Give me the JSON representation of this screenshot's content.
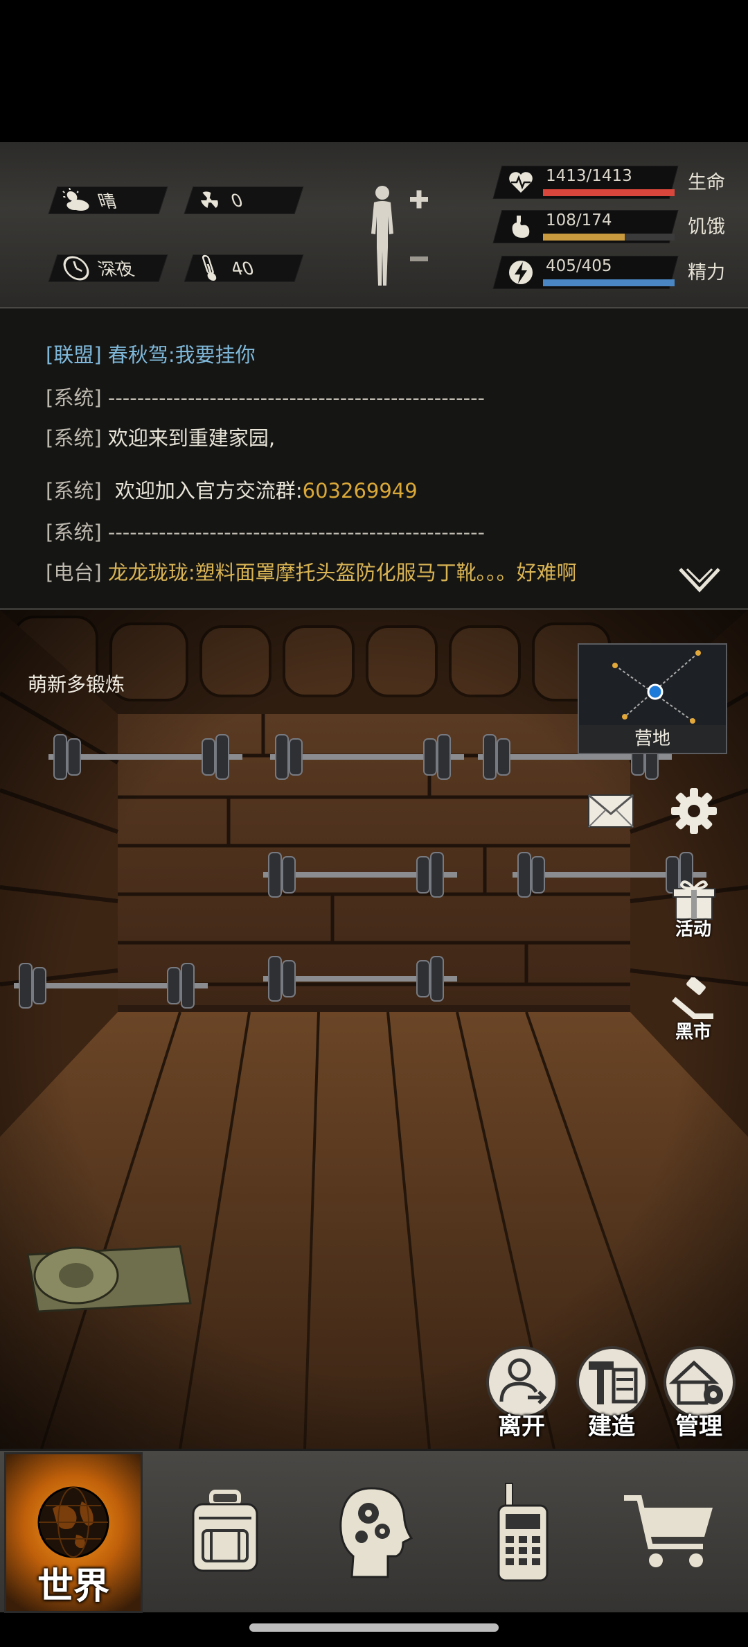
{
  "header": {
    "weather": {
      "icon": "cloudy-sun-icon",
      "label": "晴"
    },
    "radiation": {
      "icon": "radiation-icon",
      "value": "0"
    },
    "time_of_day": {
      "icon": "clock-icon",
      "label": "深夜"
    },
    "temperature": {
      "icon": "thermometer-icon",
      "value": "40"
    },
    "body_status": {
      "icon": "body-figure-icon"
    },
    "bars": [
      {
        "key": "health",
        "icon": "heart-pulse-icon",
        "value": "1413/1413",
        "label": "生命",
        "current": 1413,
        "max": 1413,
        "color": "#d9473c"
      },
      {
        "key": "hunger",
        "icon": "stomach-icon",
        "value": "108/174",
        "label": "饥饿",
        "current": 108,
        "max": 174,
        "color": "#c99a3e"
      },
      {
        "key": "energy",
        "icon": "lightning-icon",
        "value": "405/405",
        "label": "精力",
        "current": 405,
        "max": 405,
        "color": "#4a86c4"
      }
    ]
  },
  "chat": {
    "lines": [
      {
        "tag": "[联盟]",
        "name": "春秋驾",
        "text": ":我要挂你"
      },
      {
        "tag": "[系统]",
        "text": "----------------------------------------------------"
      },
      {
        "tag": "[系统]",
        "text": "欢迎来到重建家园,"
      },
      {
        "tag": "[系统]",
        "text": "欢迎加入官方交流群:",
        "highlight": "603269949"
      },
      {
        "tag": "[系统]",
        "text": "----------------------------------------------------"
      },
      {
        "tag": "[电台]",
        "name": "龙龙珑珑",
        "text": ":塑料面罩摩托头盔防化服马丁靴。。。好难啊"
      }
    ],
    "toggle_icon": "chevron-down-icon"
  },
  "scene": {
    "room_title": "萌新多锻炼",
    "minimap_label": "营地",
    "side_buttons": {
      "mail": {
        "icon": "mail-icon"
      },
      "settings": {
        "icon": "gear-icon"
      },
      "events": {
        "icon": "gift-icon",
        "label": "活动"
      },
      "black_market": {
        "icon": "gavel-icon",
        "label": "黑市"
      }
    },
    "actions": [
      {
        "key": "leave",
        "icon": "leave-person-icon",
        "label": "离开"
      },
      {
        "key": "build",
        "icon": "build-hammer-icon",
        "label": "建造"
      },
      {
        "key": "manage",
        "icon": "manage-house-icon",
        "label": "管理"
      }
    ]
  },
  "nav": {
    "world": {
      "icon": "globe-icon",
      "label": "世界"
    },
    "items": [
      {
        "key": "backpack",
        "icon": "backpack-icon"
      },
      {
        "key": "skills",
        "icon": "head-gears-icon"
      },
      {
        "key": "radio",
        "icon": "walkie-talkie-icon"
      },
      {
        "key": "shop",
        "icon": "cart-icon"
      }
    ]
  }
}
